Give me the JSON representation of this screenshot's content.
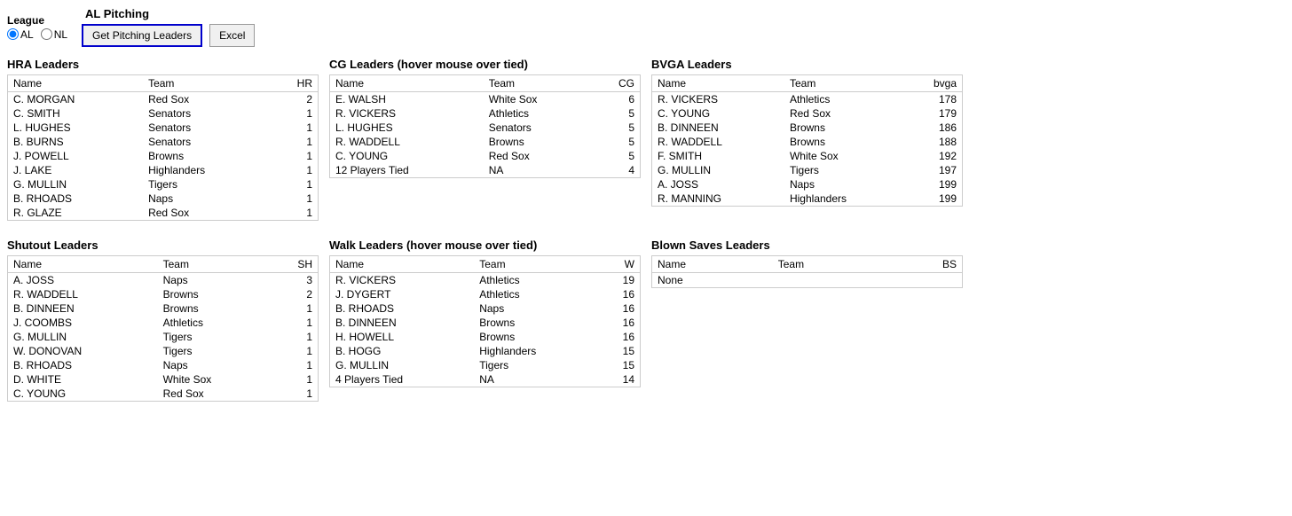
{
  "controls": {
    "league_label": "League",
    "al_label": "AL",
    "nl_label": "NL",
    "al_selected": true,
    "section_title": "AL Pitching",
    "get_pitching_label": "Get Pitching Leaders",
    "excel_label": "Excel"
  },
  "hra_leaders": {
    "title": "HRA Leaders",
    "columns": [
      "Name",
      "Team",
      "HR"
    ],
    "rows": [
      [
        "C. MORGAN",
        "Red Sox",
        "2"
      ],
      [
        "C. SMITH",
        "Senators",
        "1"
      ],
      [
        "L. HUGHES",
        "Senators",
        "1"
      ],
      [
        "B. BURNS",
        "Senators",
        "1"
      ],
      [
        "J. POWELL",
        "Browns",
        "1"
      ],
      [
        "J. LAKE",
        "Highlanders",
        "1"
      ],
      [
        "G. MULLIN",
        "Tigers",
        "1"
      ],
      [
        "B. RHOADS",
        "Naps",
        "1"
      ],
      [
        "R. GLAZE",
        "Red Sox",
        "1"
      ]
    ]
  },
  "cg_leaders": {
    "title": "CG Leaders (hover mouse over tied)",
    "columns": [
      "Name",
      "Team",
      "CG"
    ],
    "rows": [
      [
        "E. WALSH",
        "White Sox",
        "6"
      ],
      [
        "R. VICKERS",
        "Athletics",
        "5"
      ],
      [
        "L. HUGHES",
        "Senators",
        "5"
      ],
      [
        "R. WADDELL",
        "Browns",
        "5"
      ],
      [
        "C. YOUNG",
        "Red Sox",
        "5"
      ],
      [
        "12 Players Tied",
        "NA",
        "4"
      ]
    ]
  },
  "bvga_leaders": {
    "title": "BVGA Leaders",
    "columns": [
      "Name",
      "Team",
      "bvga"
    ],
    "rows": [
      [
        "R. VICKERS",
        "Athletics",
        "178"
      ],
      [
        "C. YOUNG",
        "Red Sox",
        "179"
      ],
      [
        "B. DINNEEN",
        "Browns",
        "186"
      ],
      [
        "R. WADDELL",
        "Browns",
        "188"
      ],
      [
        "F. SMITH",
        "White Sox",
        "192"
      ],
      [
        "G. MULLIN",
        "Tigers",
        "197"
      ],
      [
        "A. JOSS",
        "Naps",
        "199"
      ],
      [
        "R. MANNING",
        "Highlanders",
        "199"
      ]
    ]
  },
  "shutout_leaders": {
    "title": "Shutout Leaders",
    "columns": [
      "Name",
      "Team",
      "SH"
    ],
    "rows": [
      [
        "A. JOSS",
        "Naps",
        "3"
      ],
      [
        "R. WADDELL",
        "Browns",
        "2"
      ],
      [
        "B. DINNEEN",
        "Browns",
        "1"
      ],
      [
        "J. COOMBS",
        "Athletics",
        "1"
      ],
      [
        "G. MULLIN",
        "Tigers",
        "1"
      ],
      [
        "W. DONOVAN",
        "Tigers",
        "1"
      ],
      [
        "B. RHOADS",
        "Naps",
        "1"
      ],
      [
        "D. WHITE",
        "White Sox",
        "1"
      ],
      [
        "C. YOUNG",
        "Red Sox",
        "1"
      ]
    ]
  },
  "walk_leaders": {
    "title": "Walk Leaders (hover mouse over tied)",
    "columns": [
      "Name",
      "Team",
      "W"
    ],
    "rows": [
      [
        "R. VICKERS",
        "Athletics",
        "19"
      ],
      [
        "J. DYGERT",
        "Athletics",
        "16"
      ],
      [
        "B. RHOADS",
        "Naps",
        "16"
      ],
      [
        "B. DINNEEN",
        "Browns",
        "16"
      ],
      [
        "H. HOWELL",
        "Browns",
        "16"
      ],
      [
        "B. HOGG",
        "Highlanders",
        "15"
      ],
      [
        "G. MULLIN",
        "Tigers",
        "15"
      ],
      [
        "4 Players Tied",
        "NA",
        "14"
      ]
    ]
  },
  "blown_saves": {
    "title": "Blown Saves Leaders",
    "columns": [
      "Name",
      "Team",
      "BS"
    ],
    "rows": [
      [
        "None",
        "",
        ""
      ]
    ]
  }
}
